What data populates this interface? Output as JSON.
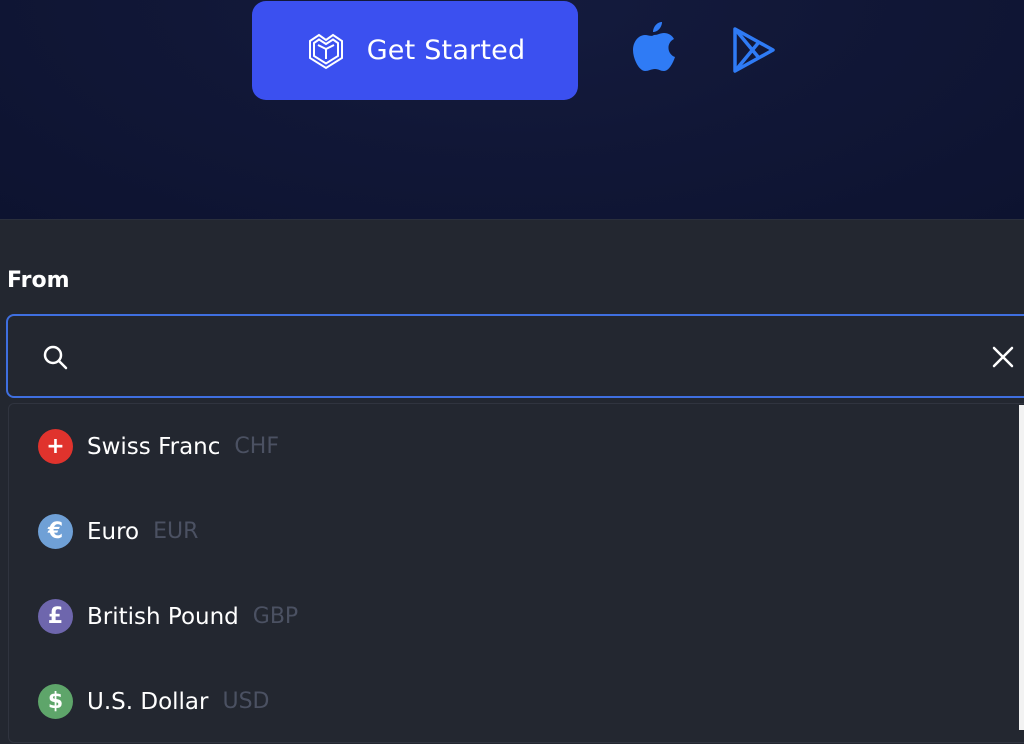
{
  "hero": {
    "cta_label": "Get Started",
    "cta_color": "#3b50f0",
    "icons": [
      "brand-logo-icon",
      "apple-icon",
      "play-store-icon"
    ]
  },
  "converter": {
    "from_label": "From",
    "search": {
      "value": "",
      "placeholder": ""
    },
    "options": [
      {
        "name": "Swiss Franc",
        "code": "CHF",
        "symbol": "+",
        "color": "#e0332d"
      },
      {
        "name": "Euro",
        "code": "EUR",
        "symbol": "€",
        "color": "#6fa0d6"
      },
      {
        "name": "British Pound",
        "code": "GBP",
        "symbol": "£",
        "color": "#6e66ad"
      },
      {
        "name": "U.S. Dollar",
        "code": "USD",
        "symbol": "$",
        "color": "#5ea56a"
      }
    ]
  }
}
